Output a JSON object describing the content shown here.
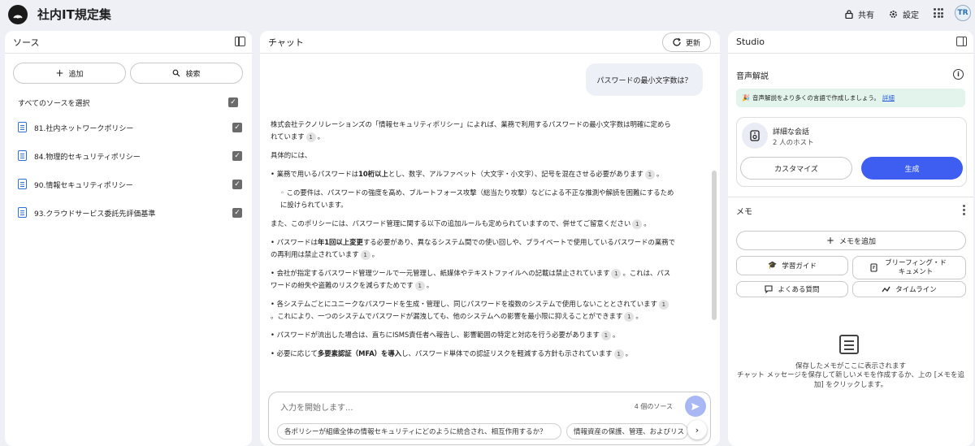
{
  "app": {
    "title": "社内IT規定集"
  },
  "topbar": {
    "share_label": "共有",
    "settings_label": "設定",
    "avatar_text": "TR"
  },
  "sources": {
    "title": "ソース",
    "add_label": "追加",
    "search_label": "検索",
    "select_all_label": "すべてのソースを選択",
    "items": [
      {
        "label": "81.社内ネットワークポリシー",
        "checked": true
      },
      {
        "label": "84.物理的セキュリティポリシー",
        "checked": true
      },
      {
        "label": "90.情報セキュリティポリシー",
        "checked": true
      },
      {
        "label": "93.クラウドサービス委託先評価基準",
        "checked": true
      }
    ]
  },
  "chat": {
    "title": "チャット",
    "refresh_label": "更新",
    "user_message": "パスワードの最小文字数は？",
    "answer": {
      "p1": "株式会社テクノリレーションズの「情報セキュリティポリシー」によれば、業務で利用するパスワードの最小文字数は明確に定められています",
      "p2": "具体的には、",
      "b1_pre": "• 業務で用いるパスワードは",
      "b1_bold": "10桁以上",
      "b1_post": "とし、数字、アルファベット（大文字・小文字）、記号を混在させる必要があります",
      "b1_sub": "◦ この要件は、パスワードの強度を高め、ブルートフォース攻撃（総当たり攻撃）などによる不正な推測や解読を困難にするために設けられています。",
      "p3": "また、このポリシーには、パスワード管理に関する以下の追加ルールも定められていますので、併せてご留意ください",
      "b2_pre": "• パスワードは",
      "b2_bold": "年1回以上変更",
      "b2_post": "する必要があり、異なるシステム間での使い回しや、プライベートで使用しているパスワードの業務での再利用は禁止されています",
      "b3": "• 会社が指定するパスワード管理ツールで一元管理し、紙媒体やテキストファイルへの記載は禁止されています",
      "b3_post": "。これは、パスワードの紛失や盗難のリスクを減らすためです",
      "b4": "• 各システムごとにユニークなパスワードを生成・管理し、同じパスワードを複数のシステムで使用しないこととされています",
      "b4_post": "。これにより、一つのシステムでパスワードが漏洩しても、他のシステムへの影響を最小限に抑えることができます",
      "b5": "• パスワードが流出した場合は、直ちにISMS責任者へ報告し、影響範囲の特定と対応を行う必要があります",
      "b6_pre": "• 必要に応じて",
      "b6_bold": "多要素認証（MFA）を導入",
      "b6_post": "し、パスワード単体での認証リスクを軽減する方針も示されています",
      "cite": "1"
    },
    "input_placeholder": "入力を開始します...",
    "source_count": "4 個のソース",
    "suggestions": [
      "各ポリシーが組織全体の情報セキュリティにどのように統合され、相互作用するか？",
      "情報資産の保護、管理、およびリス"
    ]
  },
  "studio": {
    "title": "Studio",
    "audio_title": "音声解説",
    "banner_text": "音声解説をより多くの言語で作成しましょう。",
    "banner_link": "詳細",
    "card_title": "詳細な会話",
    "card_sub": "2 人のホスト",
    "customize_label": "カスタマイズ",
    "generate_label": "生成",
    "memo_title": "メモ",
    "add_memo_label": "メモを追加",
    "study_guide_label": "学習ガイド",
    "briefing_label": "ブリーフィング・ドキュメント",
    "faq_label": "よくある質問",
    "timeline_label": "タイムライン",
    "empty_title": "保存したメモがここに表示されます",
    "empty_desc": "チャット メッセージを保存して新しいメモを作成するか、上の [メモを追加] をクリックします。"
  },
  "colors": {
    "accent": "#3d5ef0",
    "background": "#eef0f6",
    "banner": "#e3f4ec"
  }
}
